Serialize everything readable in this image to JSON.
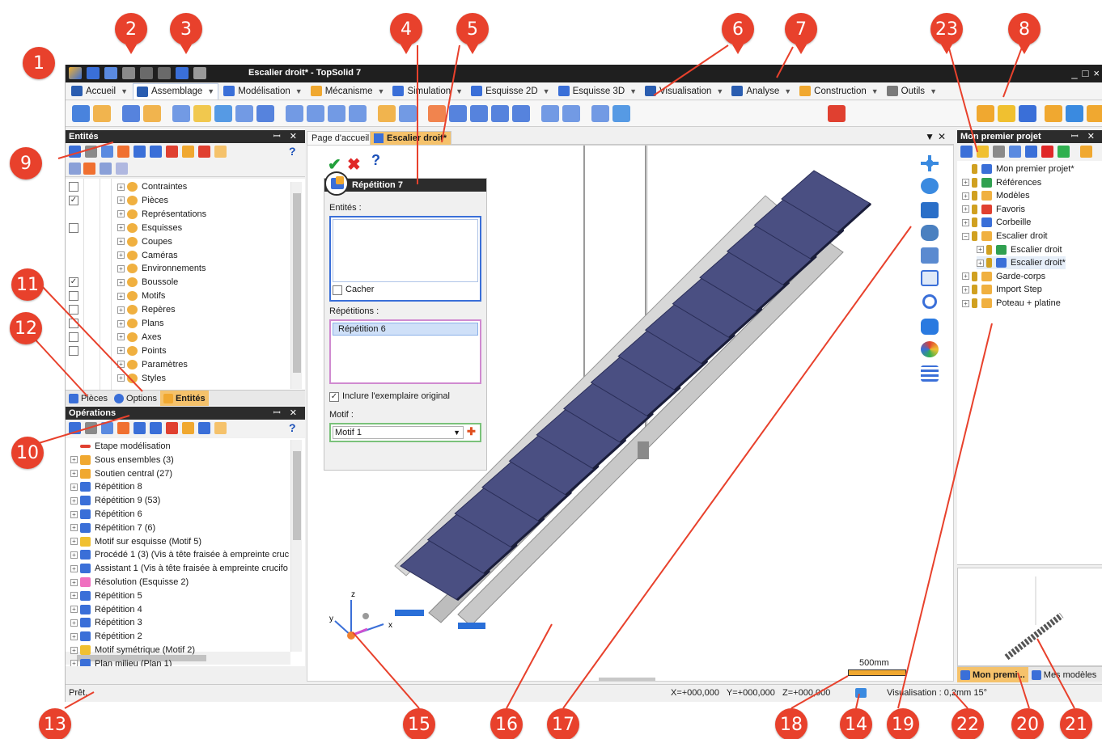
{
  "app": {
    "title": "Escalier droit* - TopSolid 7"
  },
  "window_controls": [
    "_",
    "□",
    "×"
  ],
  "ribbon_tabs": [
    {
      "label": "Accueil",
      "color": "#2a5db0",
      "active": false
    },
    {
      "label": "Assemblage",
      "color": "#2a5db0",
      "active": true
    },
    {
      "label": "Modélisation",
      "color": "#3a6fd8",
      "active": false
    },
    {
      "label": "Mécanisme",
      "color": "#f0a830",
      "active": false
    },
    {
      "label": "Simulation",
      "color": "#3a6fd8",
      "active": false
    },
    {
      "label": "Esquisse 2D",
      "color": "#3a6fd8",
      "active": false
    },
    {
      "label": "Esquisse 3D",
      "color": "#3a6fd8",
      "active": false
    },
    {
      "label": "Visualisation",
      "color": "#2a5db0",
      "active": false
    },
    {
      "label": "Analyse",
      "color": "#2a5db0",
      "active": false
    },
    {
      "label": "Construction",
      "color": "#f0a830",
      "active": false
    },
    {
      "label": "Outils",
      "color": "#7a7a7a",
      "active": false
    }
  ],
  "entities_panel": {
    "title": "Entités",
    "pin": "ꟷ ✕",
    "help": "?",
    "items": [
      {
        "label": "Contraintes",
        "checked": false,
        "has_box": true
      },
      {
        "label": "Pièces",
        "checked": true,
        "has_box": true
      },
      {
        "label": "Représentations",
        "checked": false,
        "has_box": false
      },
      {
        "label": "Esquisses",
        "checked": false,
        "has_box": true
      },
      {
        "label": "Coupes",
        "checked": false,
        "has_box": false
      },
      {
        "label": "Caméras",
        "checked": false,
        "has_box": false
      },
      {
        "label": "Environnements",
        "checked": false,
        "has_box": false
      },
      {
        "label": "Boussole",
        "checked": true,
        "has_box": true
      },
      {
        "label": "Motifs",
        "checked": false,
        "has_box": true
      },
      {
        "label": "Repères",
        "checked": false,
        "has_box": true
      },
      {
        "label": "Plans",
        "checked": false,
        "has_box": true
      },
      {
        "label": "Axes",
        "checked": false,
        "has_box": true
      },
      {
        "label": "Points",
        "checked": false,
        "has_box": true
      },
      {
        "label": "Paramètres",
        "checked": false,
        "has_box": false
      },
      {
        "label": "Styles",
        "checked": false,
        "has_box": false
      }
    ],
    "bottom_tabs": [
      "Pièces",
      "Options",
      "Entités"
    ]
  },
  "operations_panel": {
    "title": "Opérations",
    "help": "?",
    "items": [
      "Etape modélisation",
      "Sous ensembles (3)",
      "Soutien central (27)",
      "Répétition 8",
      "Répétition 9 (53)",
      "Répétition 6",
      "Répétition 7 (6)",
      "Motif sur esquisse (Motif 5)",
      "Procédé 1 (3) (Vis à tête fraisée à empreinte cruc",
      "Assistant 1 (Vis à tête fraisée à empreinte crucifo",
      "Résolution (Esquisse 2)",
      "Répétition 5",
      "Répétition 4",
      "Répétition 3",
      "Répétition 2",
      "Motif symétrique (Motif 2)",
      "Plan milieu (Plan 1)"
    ]
  },
  "document_tabs": [
    "Page d'accueil",
    "Escalier droit*"
  ],
  "dialog": {
    "ok": "✔",
    "cancel": "✖",
    "help": "?",
    "title": "Répétition 7",
    "entities_label": "Entités :",
    "hide_label": "Cacher",
    "hide_checked": false,
    "repetitions_label": "Répétitions :",
    "repetitions": [
      "Répétition 6"
    ],
    "include_label": "Inclure l'exemplaire original",
    "include_checked": true,
    "pattern_label": "Motif :",
    "pattern_value": "Motif 1",
    "add_symbol": "✚"
  },
  "viewport": {
    "scale_label": "500mm",
    "triad": {
      "x": "x",
      "y": "y",
      "z": "z"
    },
    "stair_steps": 15
  },
  "project_panel": {
    "title": "Mon premier projet",
    "items": [
      {
        "label": "Mon premier projet*",
        "level": 0,
        "exp": ""
      },
      {
        "label": "Références",
        "level": 0,
        "exp": "+"
      },
      {
        "label": "Modèles",
        "level": 0,
        "exp": "+"
      },
      {
        "label": "Favoris",
        "level": 0,
        "exp": "+"
      },
      {
        "label": "Corbeille",
        "level": 0,
        "exp": "+"
      },
      {
        "label": "Escalier droit",
        "level": 0,
        "exp": "−"
      },
      {
        "label": "Escalier droit",
        "level": 1,
        "exp": "+"
      },
      {
        "label": "Escalier droit*",
        "level": 1,
        "exp": "+"
      },
      {
        "label": "Garde-corps",
        "level": 0,
        "exp": "+"
      },
      {
        "label": "Import Step",
        "level": 0,
        "exp": "+"
      },
      {
        "label": "Poteau + platine",
        "level": 0,
        "exp": "+"
      }
    ],
    "bottom_tabs": [
      "Mon premi...",
      "Mes modèles"
    ]
  },
  "status": {
    "text": "Prêt.",
    "coords": "X=+000,000   Y=+000,000   Z=+000,000",
    "visualisation": "Visualisation : 0,2mm 15°"
  },
  "callouts": [
    "1",
    "2",
    "3",
    "4",
    "5",
    "6",
    "7",
    "8",
    "9",
    "10",
    "11",
    "12",
    "13",
    "14",
    "15",
    "16",
    "17",
    "18",
    "19",
    "20",
    "21",
    "22",
    "23"
  ],
  "colors": {
    "callout": "#e8412c",
    "active_tab": "#f5c26b",
    "panel_header": "#2c2c2c",
    "stair_tread": "#4a4f82",
    "stair_stringer": "#b8b8b8"
  }
}
